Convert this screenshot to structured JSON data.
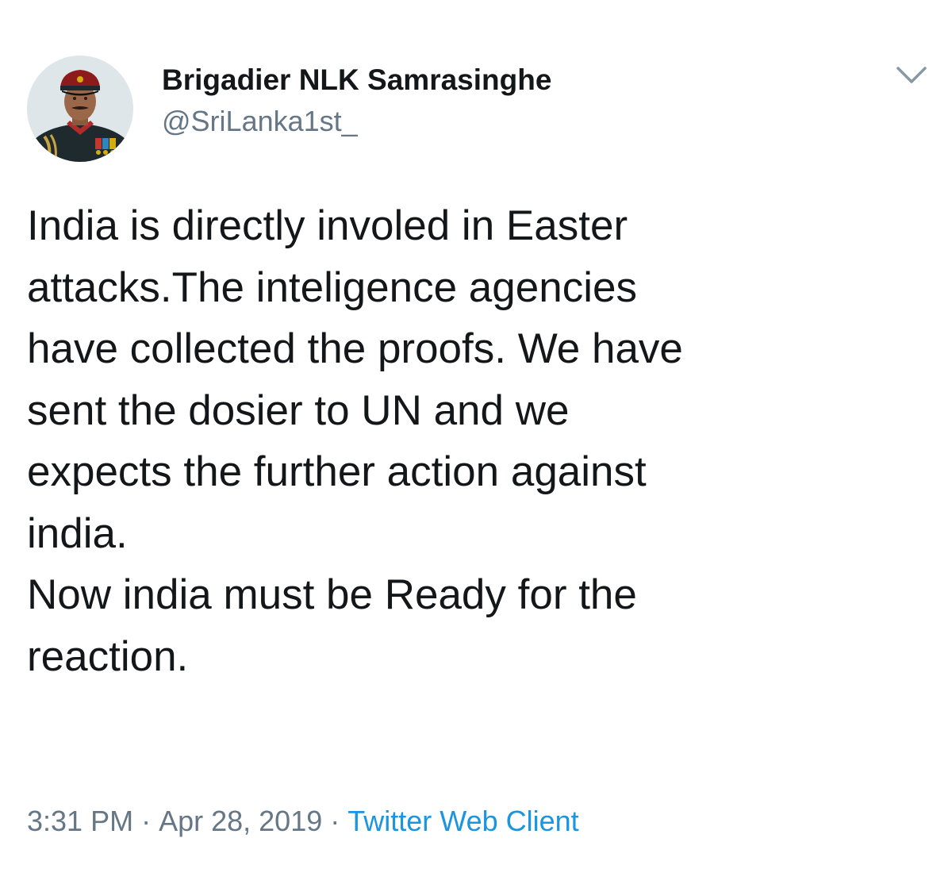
{
  "author": {
    "display_name": "Brigadier NLK Samrasinghe",
    "handle": "@SriLanka1st_"
  },
  "menu": {
    "icon": "chevron-down-icon"
  },
  "tweet": {
    "lines": [
      "India is directly involed in Easter",
      "attacks.The inteligence agencies",
      "have collected the proofs. We have",
      "sent the dosier to UN and we",
      "expects the further action against",
      "india.",
      "Now india must be Ready for the",
      "reaction."
    ]
  },
  "meta": {
    "time": "3:31 PM",
    "separator": "·",
    "date": "Apr 28, 2019",
    "source": "Twitter Web Client"
  },
  "colors": {
    "text": "#14171a",
    "secondary": "#657786",
    "link": "#1b95e0"
  }
}
